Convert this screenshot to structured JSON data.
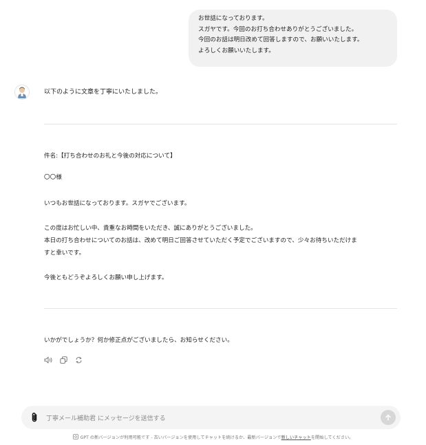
{
  "user_message": {
    "lines": [
      "お世話になっております。",
      "スガヤです。今回のお打ち合わせありがとうございました。",
      "今回のお話は明日改めて回答しますので、お願いいたします。",
      "よろしくお願いいたします。"
    ]
  },
  "assistant": {
    "intro": "以下のように文章を丁寧にいたしました。",
    "email": {
      "subject": "件名:【打ち合わせのお礼と今後の対応について】",
      "recipient": "〇〇様",
      "greeting": "いつもお世話になっております。スガヤでございます。",
      "body_line1": "この度はお忙しい中、貴重なお時間をいただき、誠にありがとうございました。",
      "body_line2": "本日の打ち合わせについてのお話は、改めて明日ご回答させていただく予定でございますので、少々お待ちいただけま",
      "body_line3": "すと幸いです。",
      "closing": "今後ともどうぞよろしくお願い申し上げます。"
    },
    "followup": "いかがでしょうか？何か修正点がございましたら、お知らせください。",
    "actions": [
      "speaker-icon",
      "copy-icon",
      "regenerate-icon"
    ]
  },
  "composer": {
    "placeholder": "丁寧メール補助君 にメッセージを送信する"
  },
  "footer": {
    "text_before": "GPT の新バージョンが利用可能です - 古いバージョンを使用してチャットを続けるか、最新バージョンで",
    "link": "新しいチャット",
    "text_after": "を開始してください。"
  },
  "colors": {
    "bubble_bg": "#f1f1f1",
    "composer_bg": "#f4f4f4",
    "send_button_bg": "#d7d7d7"
  }
}
